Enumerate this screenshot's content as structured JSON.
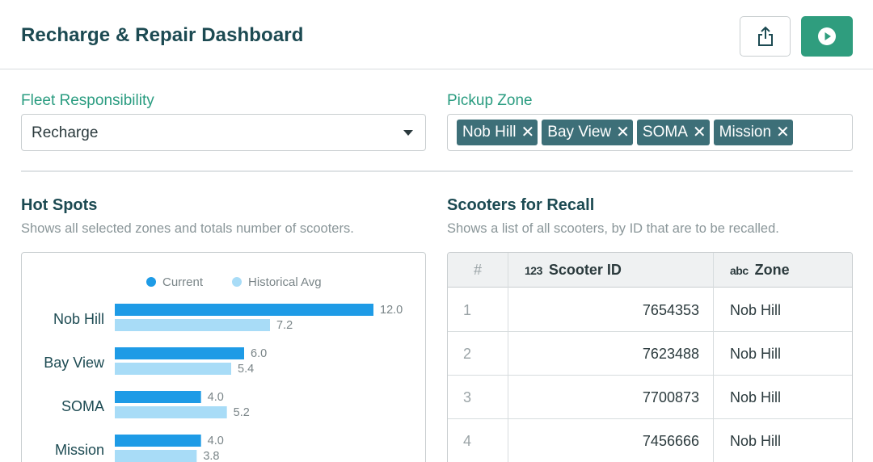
{
  "header": {
    "title": "Recharge & Repair Dashboard",
    "share_icon": "share-icon",
    "run_icon": "play-circle-icon"
  },
  "filters": {
    "fleet": {
      "label": "Fleet Responsibility",
      "value": "Recharge"
    },
    "zone": {
      "label": "Pickup Zone",
      "chips": [
        "Nob Hill",
        "Bay View",
        "SOMA",
        "Mission"
      ]
    }
  },
  "hotspots": {
    "title": "Hot Spots",
    "description": "Shows all selected zones and totals number of scooters."
  },
  "recall": {
    "title": "Scooters for Recall",
    "description": "Shows a list of all scooters, by ID that are to be recalled.",
    "columns": {
      "index": "#",
      "id_badge": "123",
      "id": "Scooter ID",
      "zone_badge": "abc",
      "zone": "Zone"
    },
    "rows": [
      {
        "n": "1",
        "id": "7654353",
        "zone": "Nob Hill"
      },
      {
        "n": "2",
        "id": "7623488",
        "zone": "Nob Hill"
      },
      {
        "n": "3",
        "id": "7700873",
        "zone": "Nob Hill"
      },
      {
        "n": "4",
        "id": "7456666",
        "zone": "Nob Hill"
      }
    ]
  },
  "chart_data": {
    "type": "bar",
    "orientation": "horizontal",
    "categories": [
      "Nob Hill",
      "Bay View",
      "SOMA",
      "Mission"
    ],
    "series": [
      {
        "name": "Current",
        "values": [
          12.0,
          6.0,
          4.0,
          4.0
        ],
        "color": "#1e9be6"
      },
      {
        "name": "Historical Avg",
        "values": [
          7.2,
          5.4,
          5.2,
          3.8
        ],
        "color": "#a8dcf7"
      }
    ],
    "xlim": [
      0,
      12
    ],
    "legend": "top",
    "grid": false
  },
  "colors": {
    "accent": "#2f9d7e",
    "chip": "#3d6f78",
    "heading": "#1c4a52"
  }
}
